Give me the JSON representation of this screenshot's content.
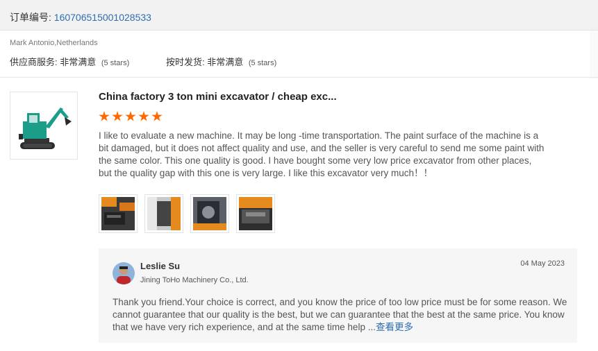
{
  "order": {
    "label": "订单编号:",
    "number": "160706515001028533"
  },
  "buyer": {
    "name_country": "Mark Antonio,Netherlands"
  },
  "ratings": [
    {
      "label": "供应商服务:",
      "value": "非常满意",
      "stars_note": "(5 stars)"
    },
    {
      "label": "按时发货:",
      "value": "非常满意",
      "stars_note": "(5 stars)"
    }
  ],
  "product": {
    "title": "China factory 3 ton mini excavator / cheap exc...",
    "rating": 5,
    "review": "I like to evaluate a new machine. It may be long -time transportation. The paint surface of the machine is a bit damaged, but it does not affect quality and use, and the seller is very careful to send me some paint with the same color. This one quality is good. I have bought some very low price excavator from other places, but the quality gap with this one is very large. I like this excavator very much！！",
    "photo_count": 4
  },
  "reply": {
    "seller_name": "Leslie Su",
    "company": "Jining ToHo Machinery Co., Ltd.",
    "date": "04 May 2023",
    "text": "Thank you friend.Your choice is correct, and you know the price of too low price must be for some reason. We cannot guarantee that our quality is the best, but we can guarantee that the best at the same price. You know that we have very rich experience, and at the same time help ...",
    "see_more": "查看更多"
  },
  "colors": {
    "accent": "#ff6a00",
    "link": "#2d6eb2",
    "excavator": "#1a9e8a"
  }
}
